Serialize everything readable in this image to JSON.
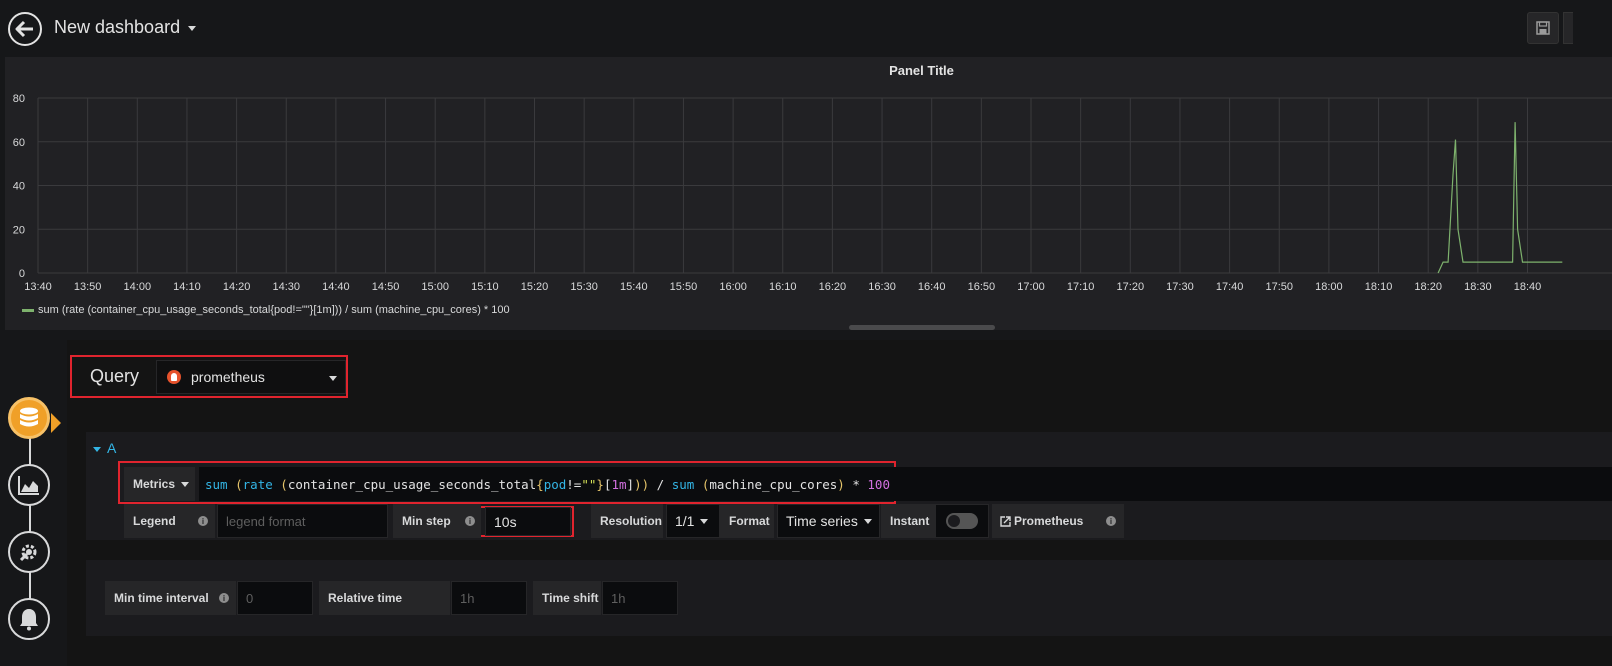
{
  "header": {
    "title": "New dashboard"
  },
  "panel": {
    "title": "Panel Title",
    "legend": "sum (rate (container_cpu_usage_seconds_total{pod!=\"\"}[1m])) / sum (machine_cpu_cores) * 100"
  },
  "chart_data": {
    "type": "line",
    "title": "Panel Title",
    "ylim": [
      0,
      80
    ],
    "yticks": [
      "0",
      "20",
      "40",
      "60",
      "80"
    ],
    "xticks": [
      "13:40",
      "13:50",
      "14:00",
      "14:10",
      "14:20",
      "14:30",
      "14:40",
      "14:50",
      "15:00",
      "15:10",
      "15:20",
      "15:30",
      "15:40",
      "15:50",
      "16:00",
      "16:10",
      "16:20",
      "16:30",
      "16:40",
      "16:50",
      "17:00",
      "17:10",
      "17:20",
      "17:30",
      "17:40",
      "17:50",
      "18:00",
      "18:10",
      "18:20",
      "18:30",
      "18:40"
    ],
    "grid": true,
    "legend_position": "bottom-left",
    "series": [
      {
        "name": "sum (rate (container_cpu_usage_seconds_total{pod!=\"\"}[1m])) / sum (machine_cpu_cores) * 100",
        "color": "#7eb26d",
        "x": [
          "18:22",
          "18:23",
          "18:24",
          "18:25",
          "18:25.5",
          "18:26",
          "18:27",
          "18:28",
          "18:30",
          "18:32",
          "18:35",
          "18:37",
          "18:37.5",
          "18:38",
          "18:39",
          "18:40",
          "18:45",
          "18:47"
        ],
        "y": [
          0,
          5,
          5,
          45,
          61,
          20,
          5,
          5,
          5,
          5,
          5,
          5,
          69,
          20,
          5,
          5,
          5,
          5
        ]
      }
    ]
  },
  "query": {
    "label": "Query",
    "datasource": "prometheus",
    "row_letter": "A",
    "metrics_label": "Metrics",
    "expr": {
      "sum1": "sum",
      "sp1": " ",
      "p1": "(",
      "rate": "rate",
      "sp2": " ",
      "p2": "(",
      "metric": "container_cpu_usage_seconds_total",
      "b1": "{",
      "lbl": "pod",
      "op1": "!=",
      "str": "\"\"",
      "b2": "}",
      "r1": "[",
      "dur": "1m",
      "r2": "]",
      "p3": ")",
      "p4": ")",
      "div": " / ",
      "sum2": "sum",
      "sp3": " ",
      "p5": "(",
      "metric2": "machine_cpu_cores",
      "p6": ")",
      "mul": " * ",
      "num": "100"
    },
    "legend_label": "Legend",
    "legend_placeholder": "legend format",
    "min_step_label": "Min step",
    "min_step_value": "10s",
    "resolution_label": "Resolution",
    "resolution_value": "1/1",
    "format_label": "Format",
    "format_value": "Time series",
    "instant_label": "Instant",
    "prometheus_link": "Prometheus"
  },
  "options": {
    "min_interval_label": "Min time interval",
    "min_interval_placeholder": "0",
    "relative_time_label": "Relative time",
    "relative_time_placeholder": "1h",
    "time_shift_label": "Time shift",
    "time_shift_placeholder": "1h"
  },
  "info_glyph": "i"
}
